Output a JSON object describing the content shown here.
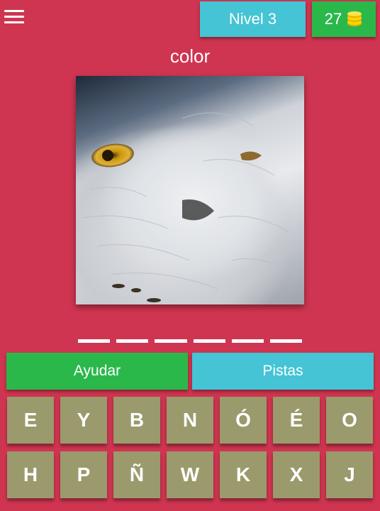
{
  "header": {
    "menu_icon": "hamburger-menu-icon",
    "level_label": "Nivel 3",
    "coins": "27",
    "coin_icon": "coin-stack-icon"
  },
  "puzzle": {
    "category": "color",
    "image_subject": "snowy owl close-up",
    "answer_length": 6
  },
  "actions": {
    "help_label": "Ayudar",
    "hints_label": "Pistas"
  },
  "keyboard": {
    "rows": [
      [
        "E",
        "Y",
        "B",
        "N",
        "Ó",
        "É",
        "O"
      ],
      [
        "H",
        "P",
        "Ñ",
        "W",
        "K",
        "X",
        "J"
      ]
    ]
  },
  "colors": {
    "background": "#cf3550",
    "level_badge": "#44c4d4",
    "coins_badge": "#2bb84b",
    "key": "#9a9a6c"
  }
}
